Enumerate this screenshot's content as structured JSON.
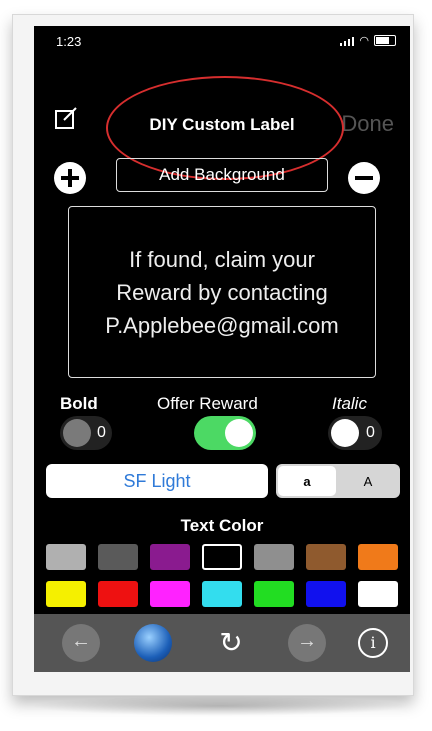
{
  "status_bar": {
    "time": "1:23"
  },
  "nav": {
    "title": "DIY Custom Label",
    "done_label": "Done",
    "compose_icon": "compose-icon"
  },
  "actions": {
    "add_background_label": "Add Background",
    "add_icon": "plus-circle-icon",
    "remove_icon": "minus-circle-icon"
  },
  "label_preview": {
    "lines": [
      "If found, claim your",
      "Reward by contacting",
      "P.Applebee@gmail.com"
    ]
  },
  "options": {
    "bold": {
      "label": "Bold",
      "count": "0"
    },
    "offer_reward": {
      "label": "Offer Reward",
      "on": true
    },
    "italic": {
      "label": "Italic",
      "count": "0"
    }
  },
  "font": {
    "name": "SF Light",
    "segment_small": "a",
    "segment_large": "A"
  },
  "text_color": {
    "title": "Text Color",
    "swatches": [
      "#b0b0b0",
      "#5a5a5a",
      "#8a1b8f",
      "#000000",
      "#8f8f8f",
      "#8f5a2e",
      "#f07a1a",
      "#f5f000",
      "#ee1111",
      "#ff22ff",
      "#33ddee",
      "#22dd22",
      "#1111ee",
      "#ffffff"
    ],
    "selected_index": 3
  },
  "toolbar": {
    "icons": [
      "back-arrow-icon",
      "globe-icon",
      "reload-icon",
      "forward-arrow-icon",
      "info-icon"
    ]
  },
  "colors": {
    "accent": "#2f7ad8",
    "toggle_on": "#4cd964",
    "annotation": "#d62e2e"
  }
}
